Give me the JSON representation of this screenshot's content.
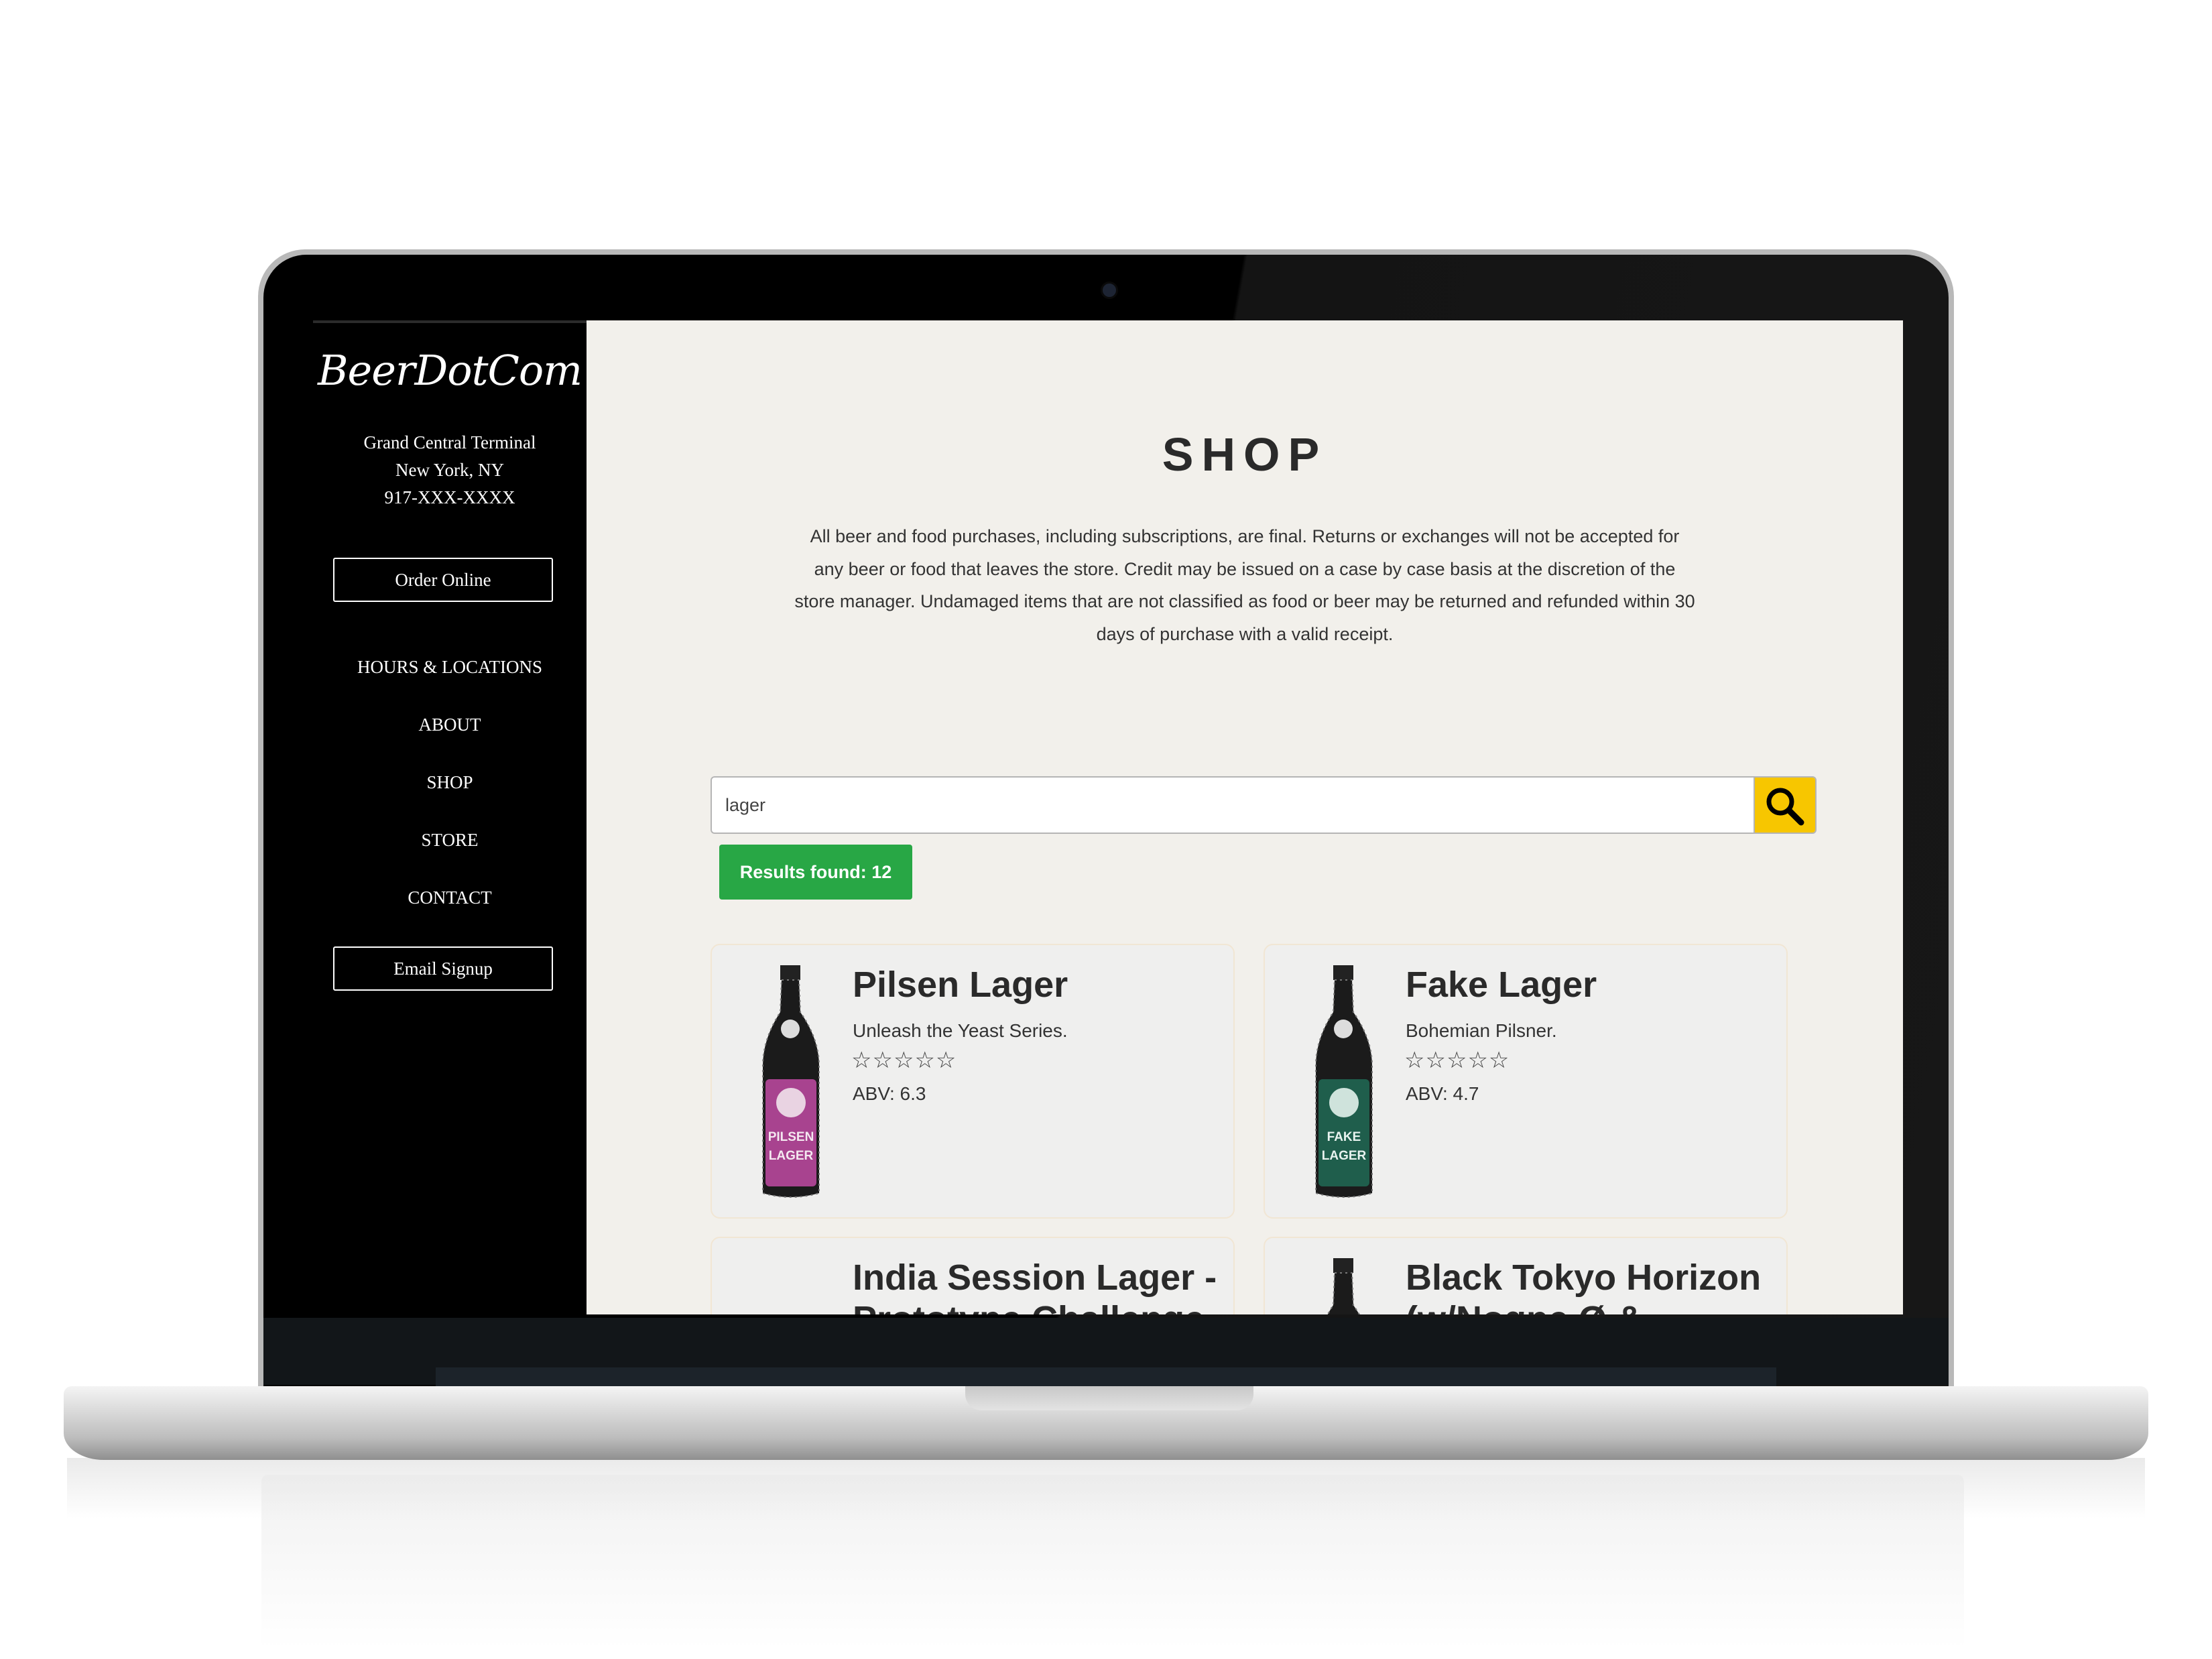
{
  "sidebar": {
    "logo": "BeerDotCom",
    "address": [
      "Grand Central Terminal",
      "New York, NY",
      "917-XXX-XXXX"
    ],
    "order_button": "Order Online",
    "nav": [
      "HOURS & LOCATIONS",
      "ABOUT",
      "SHOP",
      "STORE",
      "CONTACT"
    ],
    "email_button": "Email Signup"
  },
  "main": {
    "title": "SHOP",
    "policy": "All beer and food purchases, including subscriptions, are final. Returns or exchanges will not be accepted for any beer or food that leaves the store. Credit may be issued on a case by case basis at the discretion of the store manager. Undamaged items that are not classified as food or beer may be returned and refunded within 30 days of purchase with a valid receipt.",
    "search": {
      "value": "lager",
      "icon": "search-icon",
      "button_color": "#f7c600"
    },
    "results": "Results found: 12",
    "products": [
      {
        "name": "Pilsen Lager",
        "description": "Unleash the Yeast Series.",
        "rating": "☆☆☆☆☆",
        "abv": "ABV: 6.3",
        "label_color": "#a8438f",
        "label_text": "PILSEN LAGER"
      },
      {
        "name": "Fake Lager",
        "description": "Bohemian Pilsner.",
        "rating": "☆☆☆☆☆",
        "abv": "ABV: 4.7",
        "label_color": "#1f5e4c",
        "label_text": "FAKE LAGER"
      },
      {
        "name": "India Session Lager - Prototype Challenge",
        "description": "",
        "rating": "",
        "abv": ""
      },
      {
        "name": "Black Tokyo Horizon (w/Nogne Ø &",
        "description": "",
        "rating": "",
        "abv": ""
      }
    ]
  },
  "colors": {
    "sidebar": "#000000",
    "page_bg": "#f2f0eb",
    "badge": "#28a745",
    "card_border": "#f1e6d4"
  }
}
